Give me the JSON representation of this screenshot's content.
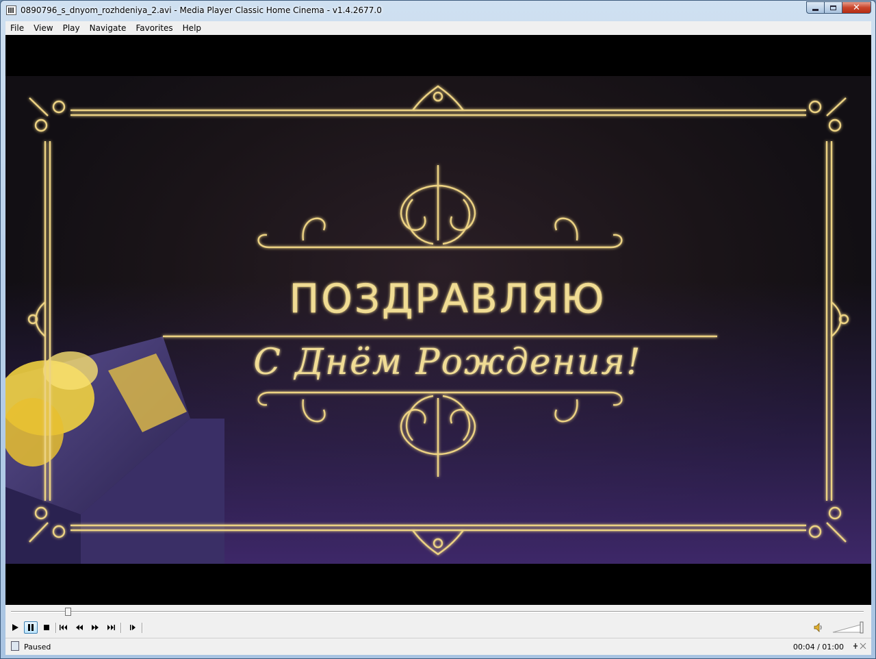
{
  "window": {
    "title": "0890796_s_dnyom_rozhdeniya_2.avi - Media Player Classic Home Cinema - v1.4.2677.0"
  },
  "menu": [
    "File",
    "View",
    "Play",
    "Navigate",
    "Favorites",
    "Help"
  ],
  "video": {
    "line1": "ПОЗДРАВЛЯЮ",
    "line2": "С Днём Рождения!"
  },
  "playback": {
    "progress": 0.067
  },
  "status": {
    "state": "Paused",
    "time": "00:04 / 01:00"
  },
  "colors": {
    "accent": "#e8cf7a",
    "close_button": "#c9452b"
  }
}
